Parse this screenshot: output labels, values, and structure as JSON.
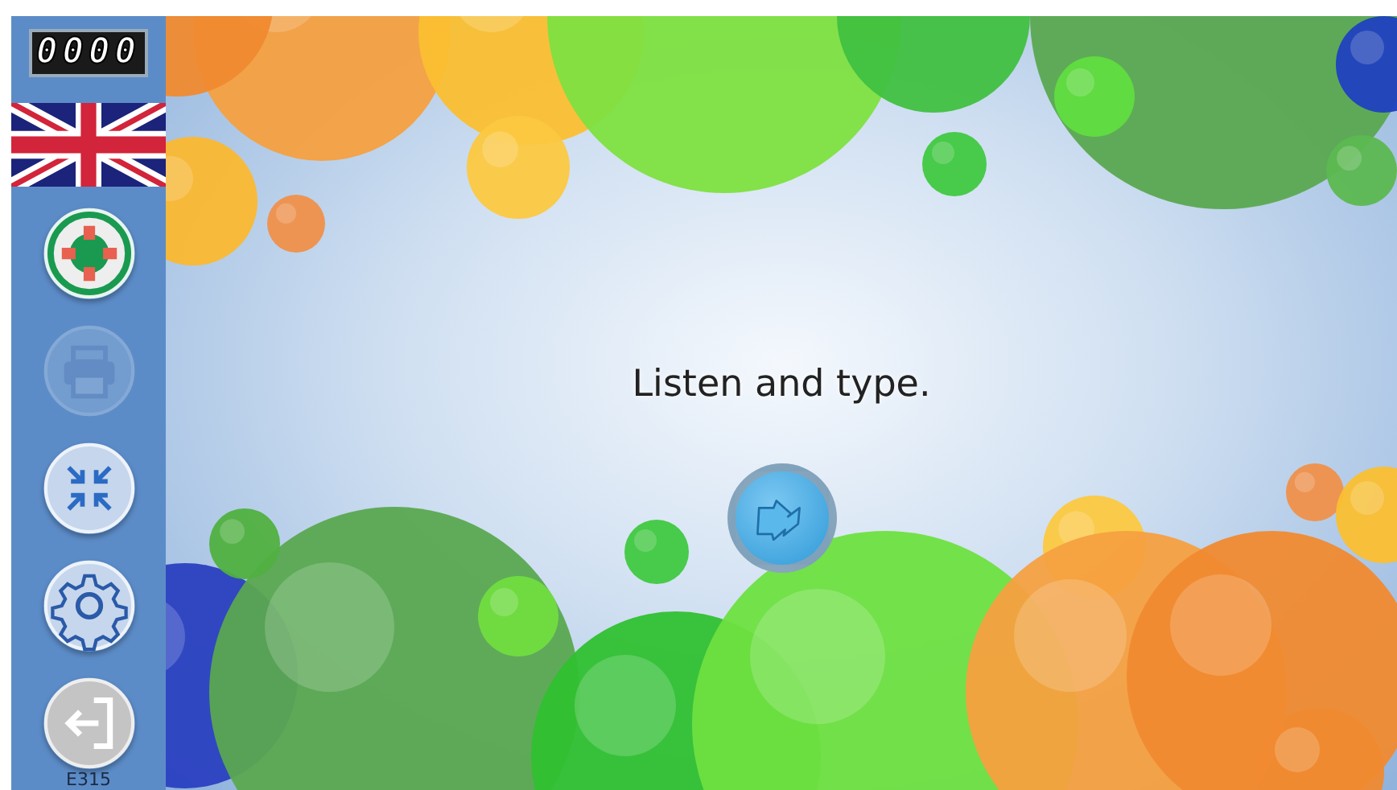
{
  "counter": "0000",
  "sidebar": {
    "buttons": [
      {
        "kind": "help",
        "disabled": false
      },
      {
        "kind": "print",
        "disabled": true
      },
      {
        "kind": "compress",
        "disabled": false
      },
      {
        "kind": "settings",
        "disabled": false
      },
      {
        "kind": "exit",
        "disabled": false
      }
    ],
    "code": "E315"
  },
  "prompt": "Listen and type."
}
